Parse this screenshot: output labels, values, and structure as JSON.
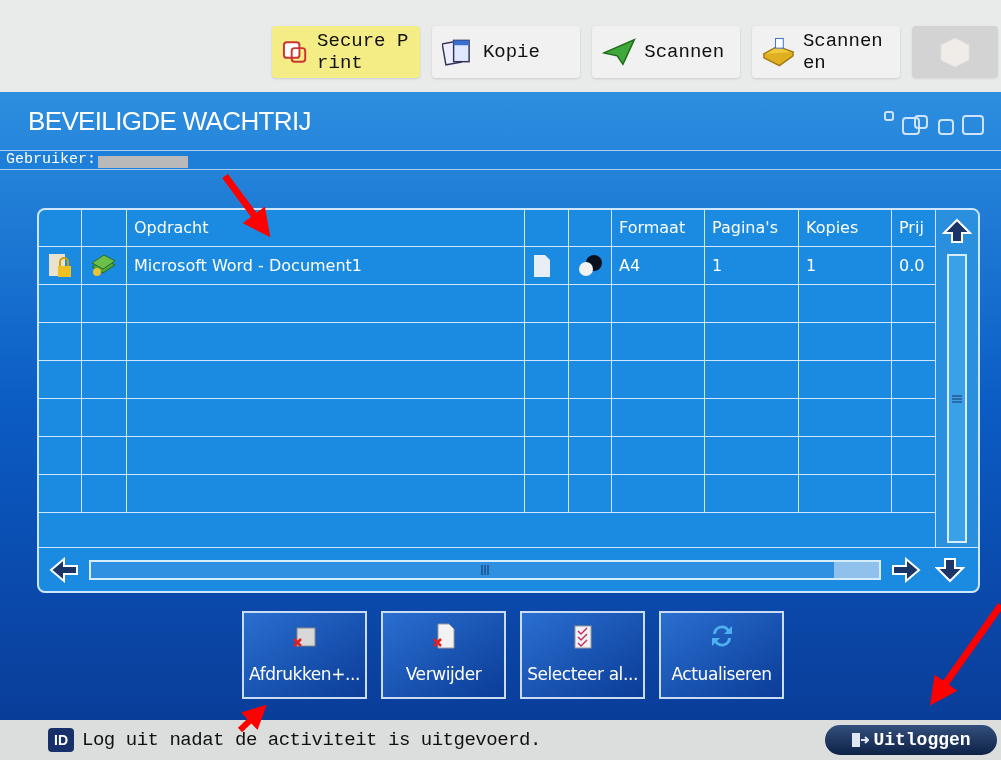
{
  "top_tabs": [
    {
      "label": "Secure Print",
      "selected": true,
      "disabled": false
    },
    {
      "label": "Kopie",
      "selected": false,
      "disabled": false
    },
    {
      "label": "Scannen",
      "selected": false,
      "disabled": false
    },
    {
      "label": "Scannen en",
      "selected": false,
      "disabled": false
    },
    {
      "selected": false,
      "disabled": true
    }
  ],
  "screen_title": "BEVEILIGDE WACHTRIJ",
  "user_label": "Gebruiker:",
  "table": {
    "columns": [
      "",
      "",
      "Opdracht",
      "",
      "",
      "Formaat",
      "Pagina's",
      "Kopies",
      "Prij"
    ],
    "rows": [
      {
        "cells": [
          "",
          "",
          "Microsoft Word - Document1",
          "",
          "",
          "A4",
          "1",
          "1",
          "0.0"
        ]
      }
    ]
  },
  "buttons": [
    "Afdrukken+...",
    "Verwijder",
    "Selecteer al...",
    "Actualiseren"
  ],
  "id_badge": "ID",
  "status_message": "Log uit nadat de activiteit is uitgevoerd.",
  "logout_button": "Uitloggen"
}
